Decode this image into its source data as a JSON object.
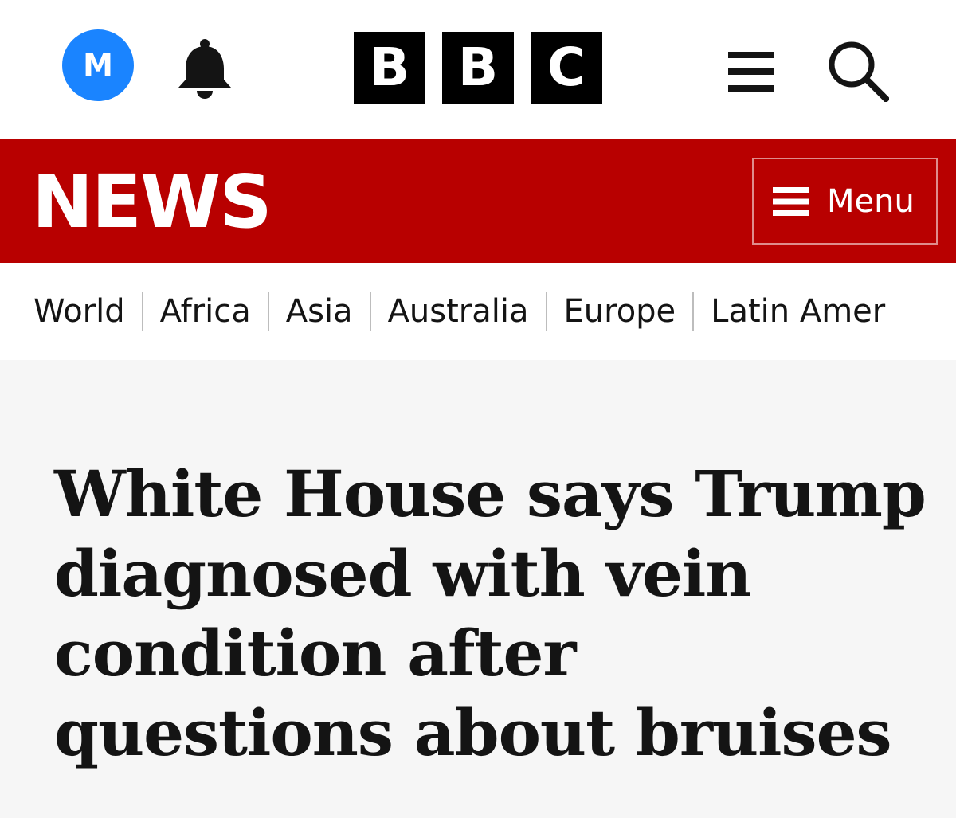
{
  "header": {
    "avatar_initial": "M",
    "logo_letters": [
      "B",
      "B",
      "C"
    ],
    "icons": {
      "account": "avatar-icon",
      "notifications": "bell-icon",
      "menu": "hamburger-icon",
      "search": "search-icon"
    }
  },
  "news_bar": {
    "title": "NEWS",
    "menu_label": "Menu",
    "background_color": "#b80000"
  },
  "nav": {
    "items": [
      "World",
      "Africa",
      "Asia",
      "Australia",
      "Europe",
      "Latin Amer"
    ]
  },
  "article": {
    "headline": "White House says Trump diagnosed with vein condition after questions about bruises"
  }
}
